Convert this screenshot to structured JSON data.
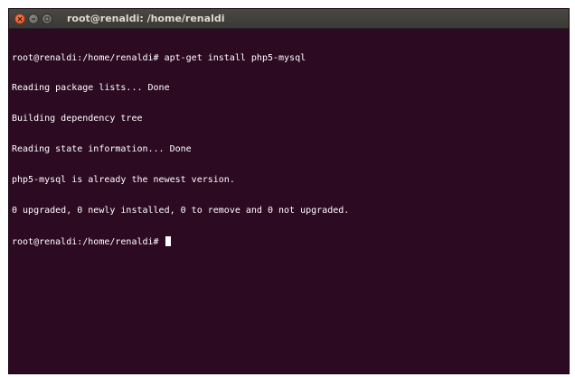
{
  "window": {
    "title": "root@renaldi: /home/renaldi"
  },
  "terminal": {
    "lines": [
      "root@renaldi:/home/renaldi# apt-get install php5-mysql",
      "Reading package lists... Done",
      "Building dependency tree",
      "Reading state information... Done",
      "php5-mysql is already the newest version.",
      "0 upgraded, 0 newly installed, 0 to remove and 0 not upgraded."
    ],
    "prompt": "root@renaldi:/home/renaldi# "
  },
  "colors": {
    "terminal_background": "#2c0a22",
    "terminal_text": "#ffffff",
    "close_button": "#e0582a"
  },
  "icons": {
    "close": "close-icon",
    "minimize": "minimize-icon",
    "maximize": "maximize-icon"
  }
}
